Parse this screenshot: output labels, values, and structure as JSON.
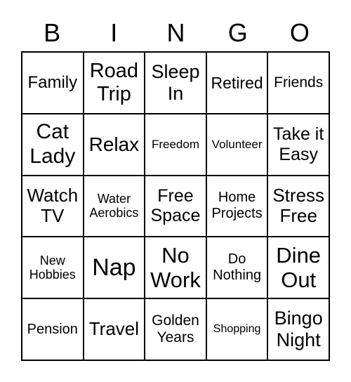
{
  "header": [
    "B",
    "I",
    "N",
    "G",
    "O"
  ],
  "cells": [
    "Family",
    "Road Trip",
    "Sleep In",
    "Retired",
    "Friends",
    "Cat Lady",
    "Relax",
    "Freedom",
    "Volunteer",
    "Take it Easy",
    "Watch TV",
    "Water Aerobics",
    "Free Space",
    "Home Projects",
    "Stress Free",
    "New Hobbies",
    "Nap",
    "No Work",
    "Do Nothing",
    "Dine Out",
    "Pension",
    "Travel",
    "Golden Years",
    "Shopping",
    "Bingo Night"
  ]
}
